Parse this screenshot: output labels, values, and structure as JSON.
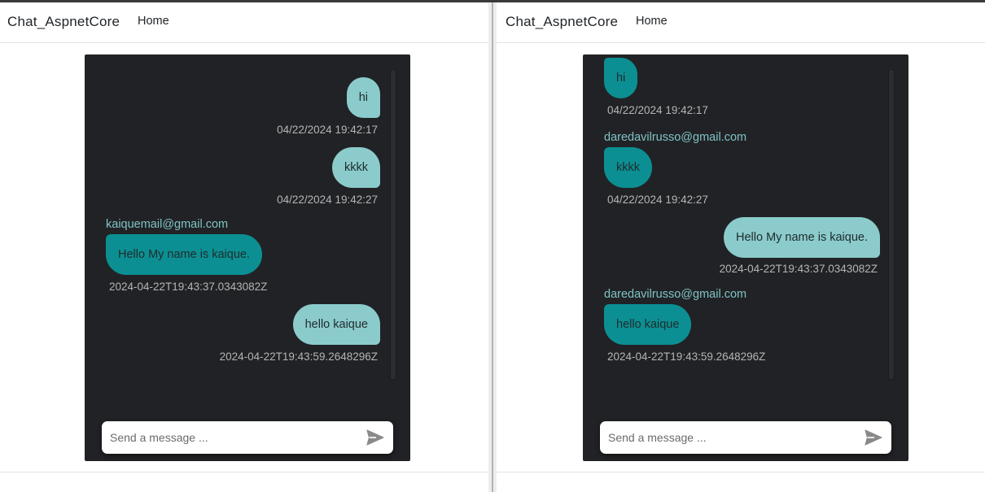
{
  "screens": {
    "left": {
      "brand": "Chat_AspnetCore",
      "nav_home": "Home",
      "placeholder": "Send a message ...",
      "messages": [
        {
          "text": "hi",
          "time": "04/22/2024 19:42:17"
        },
        {
          "text": "kkkk",
          "time": "04/22/2024 19:42:27"
        },
        {
          "user": "kaiquemail@gmail.com",
          "text": "Hello My name is kaique.",
          "time": "2024-04-22T19:43:37.0343082Z"
        },
        {
          "text": "hello kaique",
          "time": "2024-04-22T19:43:59.2648296Z"
        }
      ]
    },
    "right": {
      "brand": "Chat_AspnetCore",
      "nav_home": "Home",
      "placeholder": "Send a message ...",
      "messages": [
        {
          "text": "hi",
          "time": "04/22/2024 19:42:17"
        },
        {
          "user": "daredavilrusso@gmail.com",
          "text": "kkkk",
          "time": "04/22/2024 19:42:27"
        },
        {
          "text": "Hello My name is kaique.",
          "time": "2024-04-22T19:43:37.0343082Z"
        },
        {
          "user": "daredavilrusso@gmail.com",
          "text": "hello kaique",
          "time": "2024-04-22T19:43:59.2648296Z"
        }
      ]
    }
  },
  "icons": {
    "send": "send-icon"
  },
  "colors": {
    "own_bubble": "#8bcbcc",
    "other_bubble": "#0c8f92",
    "chat_background": "#212225",
    "username": "#7fc3c6",
    "timestamp": "#b5b5b5"
  }
}
